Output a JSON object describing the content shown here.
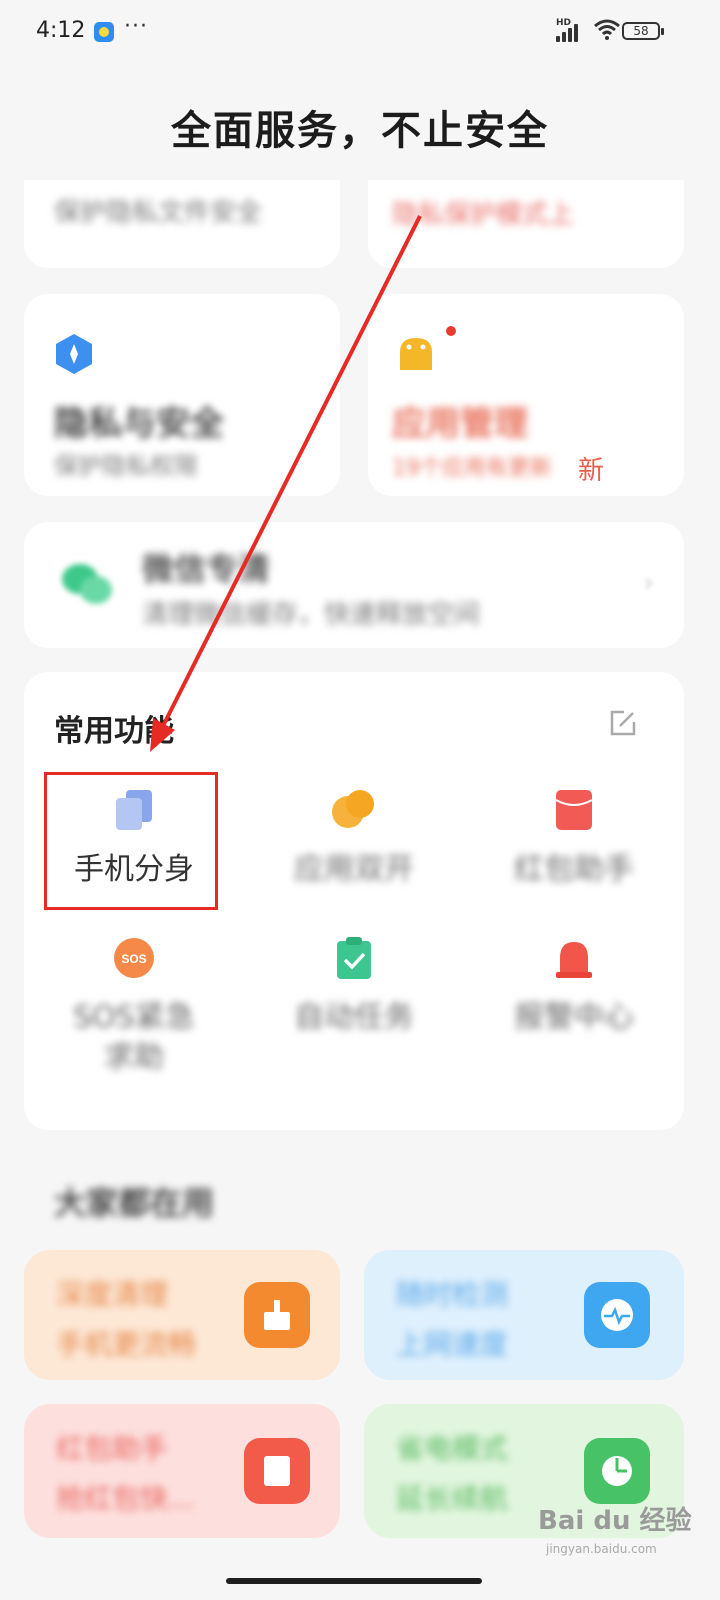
{
  "status_bar": {
    "time": "4:12",
    "more": "···",
    "signal_label": "HD",
    "battery": "58"
  },
  "header": {
    "title": "全面服务，不止安全"
  },
  "top_cards": {
    "left_text": "保护隐私文件安全",
    "right_text": "隐私保护模式上"
  },
  "cards": {
    "privacy": {
      "title": "隐私与安全",
      "subtitle": "保护隐私权限"
    },
    "app_manage": {
      "title": "应用管理",
      "subtitle": "19个应用有更新",
      "badge": "新"
    },
    "clean": {
      "title": "微信专清",
      "subtitle": "清理微信缓存，快速释放空间"
    }
  },
  "features": {
    "section_title": "常用功能",
    "items": [
      {
        "label": "手机分身",
        "icon": "dual-app-icon",
        "blurred": false
      },
      {
        "label": "应用双开",
        "icon": "dual-circle-icon",
        "blurred": true
      },
      {
        "label": "红包助手",
        "icon": "red-envelope-icon",
        "blurred": true
      },
      {
        "label": "SOS紧急求助",
        "icon": "sos-icon",
        "blurred": true
      },
      {
        "label": "自动任务",
        "icon": "clipboard-check-icon",
        "blurred": true
      },
      {
        "label": "报警中心",
        "icon": "alarm-light-icon",
        "blurred": true
      }
    ]
  },
  "recommend": {
    "section_title": "大家都在用",
    "cards": [
      {
        "line1": "深度清理",
        "line2": "手机更流畅",
        "icon": "broom-icon",
        "bg": "#fde8d6",
        "text_color": "#e6874a",
        "icon_color": "#f48a2f"
      },
      {
        "line1": "随时检测",
        "line2": "上网速度",
        "icon": "pulse-icon",
        "bg": "#dff0fd",
        "text_color": "#5aa8e8",
        "icon_color": "#3fa6f0"
      },
      {
        "line1": "红包助手",
        "line2": "抢红包快...",
        "icon": "red-packet-icon",
        "bg": "#fde0de",
        "text_color": "#e8605a",
        "icon_color": "#f25a4a"
      },
      {
        "line1": "省电模式",
        "line2": "延长续航",
        "icon": "pie-clock-icon",
        "bg": "#e2f6df",
        "text_color": "#58b860",
        "icon_color": "#47c266"
      }
    ]
  },
  "watermark": {
    "brand": "Bai du 经验",
    "url": "jingyan.baidu.com"
  },
  "colors": {
    "highlight": "#e62a24",
    "arrow": "#e62a24"
  }
}
